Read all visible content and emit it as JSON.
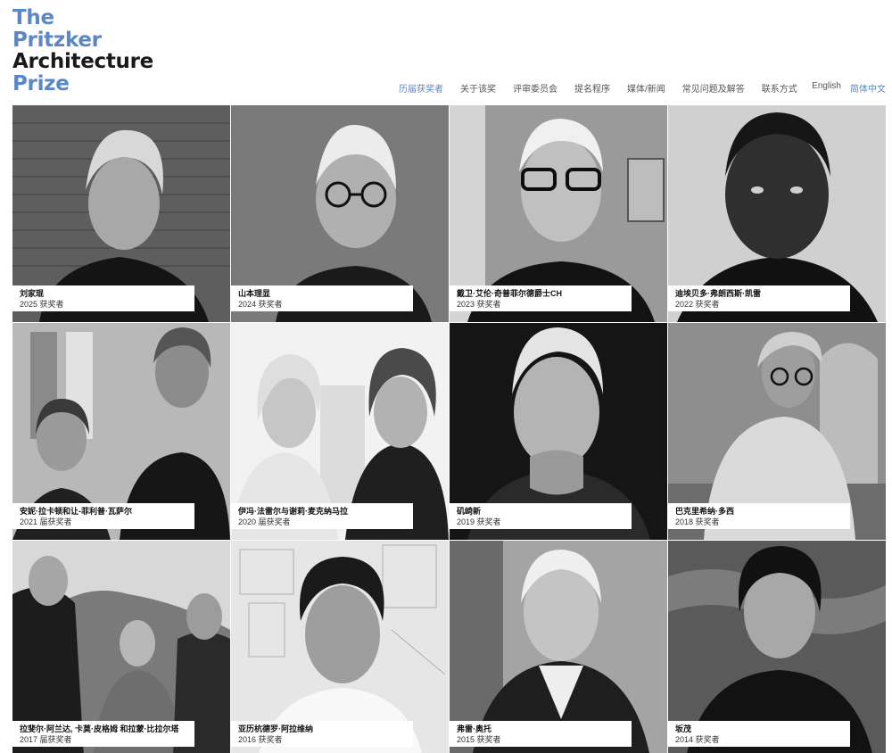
{
  "logo": {
    "line1": "The",
    "line2": "Pritzker",
    "line3": "Architecture",
    "line4": "Prize"
  },
  "nav": [
    {
      "label": "历届获奖者",
      "active": true
    },
    {
      "label": "关于该奖",
      "active": false
    },
    {
      "label": "评审委员会",
      "active": false
    },
    {
      "label": "提名程序",
      "active": false
    },
    {
      "label": "媒体/新闻",
      "active": false
    },
    {
      "label": "常见问题及解答",
      "active": false
    },
    {
      "label": "联系方式",
      "active": false
    }
  ],
  "languages": [
    {
      "label": "English",
      "active": false
    },
    {
      "label": "简体中文",
      "active": true
    }
  ],
  "colors": {
    "accent": "#5b87c7",
    "text_dark": "#1a1a1a"
  },
  "laureates": [
    {
      "name": "刘家琨",
      "year": "2025 获奖者"
    },
    {
      "name": "山本理显",
      "year": "2024 获奖者"
    },
    {
      "name": "戴卫·艾伦·奇普菲尔德爵士CH",
      "year": "2023 获奖者"
    },
    {
      "name": "迪埃贝多·弗朗西斯·凯雷",
      "year": "2022 获奖者"
    },
    {
      "name": "安妮·拉卡顿和让-菲利普·瓦萨尔",
      "year": "2021 届获奖者"
    },
    {
      "name": "伊冯·法雷尔与谢莉·麦克纳马拉",
      "year": "2020 届获奖者"
    },
    {
      "name": "矶崎新",
      "year": "2019 获奖者"
    },
    {
      "name": "巴克里希纳·多西",
      "year": "2018 获奖者"
    },
    {
      "name": "拉斐尔·阿兰达, 卡莫·皮格姆 和拉蒙·比拉尔塔",
      "year": "2017 届获奖者"
    },
    {
      "name": "亚历杭德罗·阿拉维纳",
      "year": "2016 获奖者"
    },
    {
      "name": "弗雷·奥托",
      "year": "2015 获奖者"
    },
    {
      "name": "坂茂",
      "year": "2014 获奖者"
    }
  ]
}
